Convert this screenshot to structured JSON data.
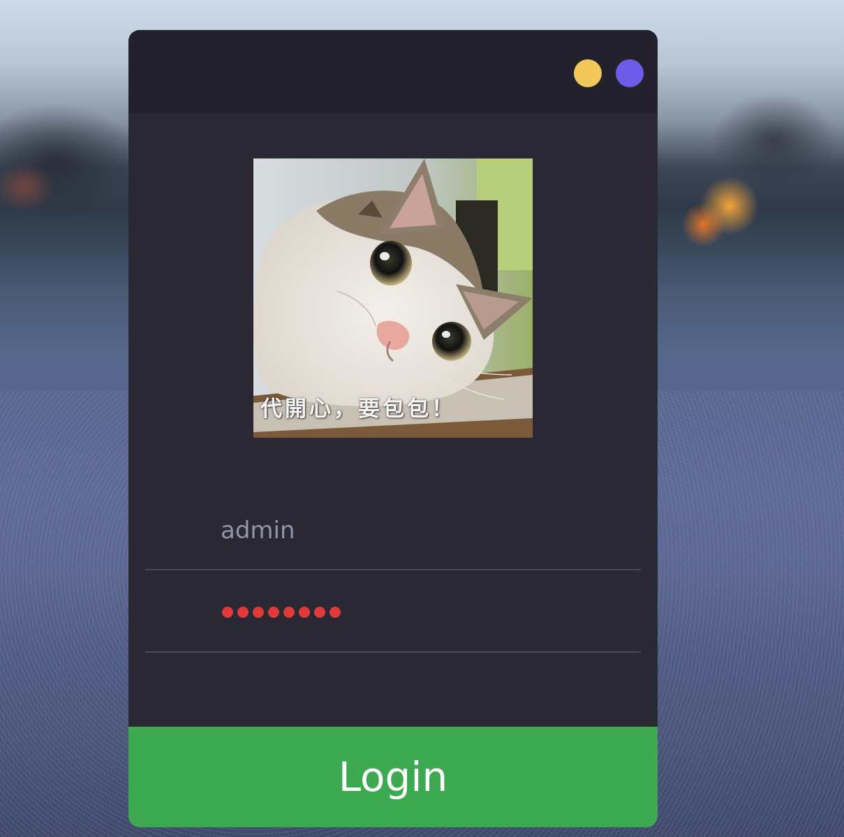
{
  "window": {
    "controls": [
      {
        "name": "minimize",
        "color": "#f2c85b"
      },
      {
        "name": "maximize",
        "color": "#6c5ce7"
      }
    ]
  },
  "avatar": {
    "caption": "代開心，要包包！"
  },
  "form": {
    "username": {
      "value": "admin"
    },
    "password": {
      "masked_length": 8,
      "dot_color": "#e03a3a"
    }
  },
  "login_button": {
    "label": "Login",
    "color": "#3da951"
  }
}
